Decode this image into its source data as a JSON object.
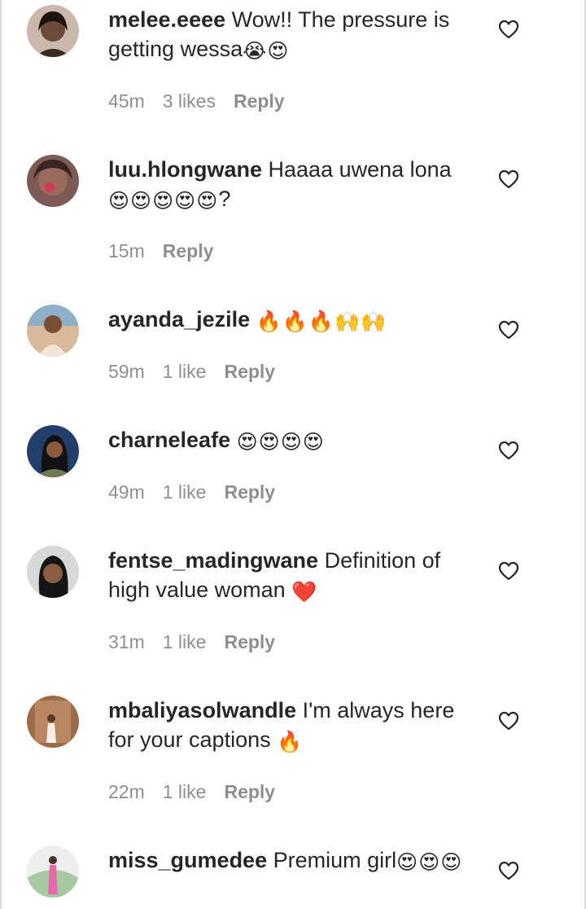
{
  "comments": [
    {
      "username": "melee.eeee",
      "text": "Wow!! The pressure is getting wessa",
      "emoji": "😭😍",
      "time": "45m",
      "likes": "3 likes",
      "reply": "Reply",
      "avatar_color": "#b39a8a"
    },
    {
      "username": "luu.hlongwane",
      "text": "Haaaa uwena lona",
      "emoji": "😍😍😍😍😍",
      "suffix": "?",
      "time": "15m",
      "likes": "",
      "reply": "Reply",
      "avatar_color": "#8d5f57"
    },
    {
      "username": "ayanda_jezile",
      "text": "",
      "emoji": "🔥🔥🔥🙌🙌",
      "time": "59m",
      "likes": "1 like",
      "reply": "Reply",
      "avatar_color": "#c59b7a"
    },
    {
      "username": "charneleafe",
      "text": "",
      "emoji": "😍😍😍😍",
      "time": "49m",
      "likes": "1 like",
      "reply": "Reply",
      "avatar_color": "#2f4e79"
    },
    {
      "username": "fentse_madingwane",
      "text": "Definition of high value woman",
      "emoji": "❤️",
      "time": "31m",
      "likes": "1 like",
      "reply": "Reply",
      "avatar_color": "#cfcfcf"
    },
    {
      "username": "mbaliyasolwandle",
      "text": "I'm always here for your captions",
      "emoji": "🔥",
      "time": "22m",
      "likes": "1 like",
      "reply": "Reply",
      "avatar_color": "#a97550"
    },
    {
      "username": "miss_gumedee",
      "text": "Premium girl",
      "emoji": "😍😍😍",
      "time": "",
      "likes": "",
      "reply": "",
      "avatar_color": "#e6e6e6"
    }
  ],
  "icons": {
    "like": "heart-outline-icon"
  }
}
